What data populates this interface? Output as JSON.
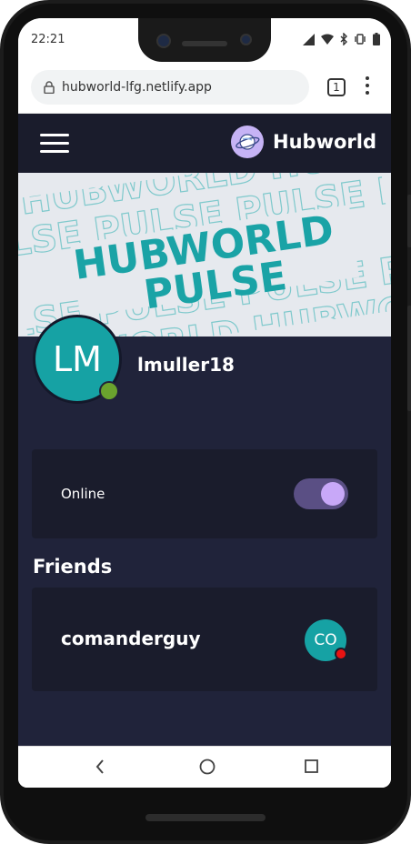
{
  "status_bar": {
    "time": "22:21"
  },
  "browser": {
    "url": "hubworld-lfg.netlify.app",
    "tab_count": "1"
  },
  "app": {
    "brand": "Hubworld",
    "banner": {
      "line1": "HUBWORLD",
      "line2": "PULSE"
    },
    "profile": {
      "initials": "LM",
      "username": "lmuller18",
      "status_color": "#6aa32e"
    },
    "online_toggle": {
      "label": "Online",
      "on": true
    },
    "friends": {
      "title": "Friends",
      "items": [
        {
          "name": "comanderguy",
          "initials": "CO",
          "status_color": "#e81313"
        }
      ]
    }
  },
  "colors": {
    "accent": "#16a2a4",
    "toggle_track": "#5a4f84",
    "toggle_knob": "#c8a8f8",
    "background": "#20233a",
    "card": "#1a1c2c"
  }
}
